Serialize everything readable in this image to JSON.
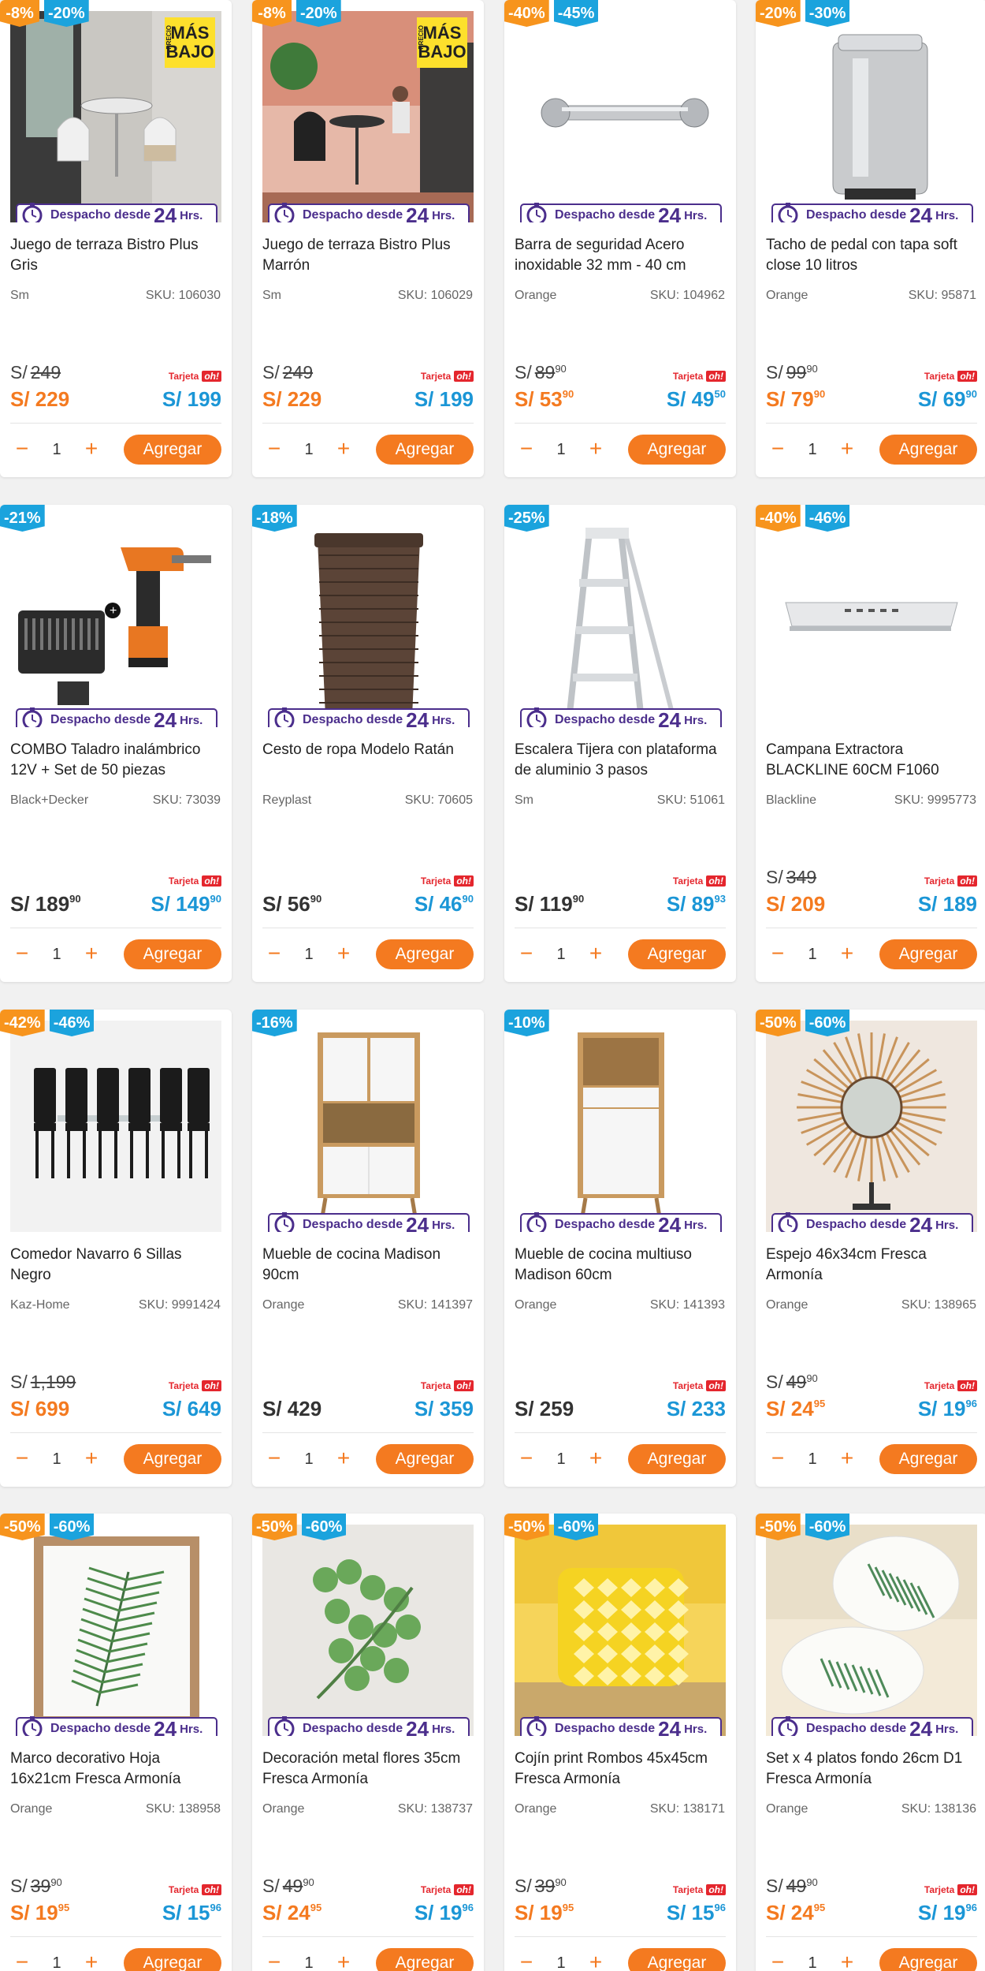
{
  "products": [
    {
      "badges": [
        {
          "text": "-8%",
          "color": "orange"
        },
        {
          "text": "-20%",
          "color": "blue"
        }
      ],
      "promo": {
        "small": "PRECIO",
        "text": "MÁS BAJO"
      },
      "dispatch": true,
      "name": "Juego de terraza Bistro Plus Gris",
      "brand": "Sm",
      "sku": "SKU: 106030",
      "old_label": "S/",
      "old_price": "249",
      "price": "S/ 229",
      "price_sup": "",
      "card_label": "Tarjeta",
      "oh_label": "oh!",
      "oh_price": "S/ 199",
      "oh_sup": "",
      "qty": "1",
      "add_label": "Agregar",
      "image": "terrace-gray"
    },
    {
      "badges": [
        {
          "text": "-8%",
          "color": "orange"
        },
        {
          "text": "-20%",
          "color": "blue"
        }
      ],
      "promo": {
        "small": "PRECIO",
        "text": "MÁS BAJO"
      },
      "dispatch": true,
      "name": "Juego de terraza Bistro Plus Marrón",
      "brand": "Sm",
      "sku": "SKU: 106029",
      "old_label": "S/",
      "old_price": "249",
      "price": "S/ 229",
      "price_sup": "",
      "card_label": "Tarjeta",
      "oh_label": "oh!",
      "oh_price": "S/ 199",
      "oh_sup": "",
      "qty": "1",
      "add_label": "Agregar",
      "image": "terrace-brown"
    },
    {
      "badges": [
        {
          "text": "-40%",
          "color": "orange"
        },
        {
          "text": "-45%",
          "color": "blue"
        }
      ],
      "promo": null,
      "dispatch": true,
      "name": "Barra de seguridad Acero inoxidable 32 mm - 40 cm",
      "brand": "Orange",
      "sku": "SKU: 104962",
      "old_label": "S/",
      "old_price": "89",
      "old_sup": "90",
      "price": "S/ 53",
      "price_sup": "90",
      "card_label": "Tarjeta",
      "oh_label": "oh!",
      "oh_price": "S/ 49",
      "oh_sup": "50",
      "qty": "1",
      "add_label": "Agregar",
      "image": "grab-bar"
    },
    {
      "badges": [
        {
          "text": "-20%",
          "color": "orange"
        },
        {
          "text": "-30%",
          "color": "blue"
        }
      ],
      "promo": null,
      "dispatch": true,
      "name": "Tacho de pedal con tapa soft close 10 litros",
      "brand": "Orange",
      "sku": "SKU: 95871",
      "old_label": "S/",
      "old_price": "99",
      "old_sup": "90",
      "price": "S/ 79",
      "price_sup": "90",
      "card_label": "Tarjeta",
      "oh_label": "oh!",
      "oh_price": "S/ 69",
      "oh_sup": "90",
      "qty": "1",
      "add_label": "Agregar",
      "image": "trash-bin"
    },
    {
      "badges": [
        {
          "text": "-21%",
          "color": "blue"
        }
      ],
      "promo": null,
      "dispatch": true,
      "name": "COMBO Taladro inalámbrico 12V + Set de 50 piezas",
      "brand": "Black+Decker",
      "sku": "SKU: 73039",
      "old_label": "",
      "old_price": "",
      "price": "S/ 189",
      "price_sup": "90",
      "price_plain": true,
      "card_label": "Tarjeta",
      "oh_label": "oh!",
      "oh_price": "S/ 149",
      "oh_sup": "90",
      "qty": "1",
      "add_label": "Agregar",
      "image": "drill"
    },
    {
      "badges": [
        {
          "text": "-18%",
          "color": "blue"
        }
      ],
      "promo": null,
      "dispatch": true,
      "name": "Cesto de ropa Modelo Ratán",
      "brand": "Reyplast",
      "sku": "SKU: 70605",
      "old_label": "",
      "old_price": "",
      "price": "S/ 56",
      "price_sup": "90",
      "price_plain": true,
      "card_label": "Tarjeta",
      "oh_label": "oh!",
      "oh_price": "S/ 46",
      "oh_sup": "90",
      "qty": "1",
      "add_label": "Agregar",
      "image": "basket"
    },
    {
      "badges": [
        {
          "text": "-25%",
          "color": "blue"
        }
      ],
      "promo": null,
      "dispatch": true,
      "name": "Escalera Tijera con plataforma de aluminio 3 pasos",
      "brand": "Sm",
      "sku": "SKU: 51061",
      "old_label": "",
      "old_price": "",
      "price": "S/ 119",
      "price_sup": "90",
      "price_plain": true,
      "card_label": "Tarjeta",
      "oh_label": "oh!",
      "oh_price": "S/ 89",
      "oh_sup": "93",
      "qty": "1",
      "add_label": "Agregar",
      "image": "ladder"
    },
    {
      "badges": [
        {
          "text": "-40%",
          "color": "orange"
        },
        {
          "text": "-46%",
          "color": "blue"
        }
      ],
      "promo": null,
      "dispatch": false,
      "name": "Campana Extractora BLACKLINE 60CM F1060",
      "brand": "Blackline",
      "sku": "SKU: 9995773",
      "old_label": "S/",
      "old_price": "349",
      "price": "S/ 209",
      "price_sup": "",
      "card_label": "Tarjeta",
      "oh_label": "oh!",
      "oh_price": "S/ 189",
      "oh_sup": "",
      "qty": "1",
      "add_label": "Agregar",
      "image": "hood"
    },
    {
      "badges": [
        {
          "text": "-42%",
          "color": "orange"
        },
        {
          "text": "-46%",
          "color": "blue"
        }
      ],
      "promo": null,
      "dispatch": false,
      "name": "Comedor Navarro 6 Sillas Negro",
      "brand": "Kaz-Home",
      "sku": "SKU: 9991424",
      "old_label": "S/",
      "old_price": "1,199",
      "price": "S/ 699",
      "price_sup": "",
      "card_label": "Tarjeta",
      "oh_label": "oh!",
      "oh_price": "S/ 649",
      "oh_sup": "",
      "qty": "1",
      "add_label": "Agregar",
      "image": "dining"
    },
    {
      "badges": [
        {
          "text": "-16%",
          "color": "blue"
        }
      ],
      "promo": null,
      "dispatch": true,
      "name": "Mueble de cocina Madison 90cm",
      "brand": "Orange",
      "sku": "SKU: 141397",
      "old_label": "",
      "old_price": "",
      "price": "S/ 429",
      "price_sup": "",
      "price_plain": true,
      "card_label": "Tarjeta",
      "oh_label": "oh!",
      "oh_price": "S/ 359",
      "oh_sup": "",
      "qty": "1",
      "add_label": "Agregar",
      "image": "cabinet-wide"
    },
    {
      "badges": [
        {
          "text": "-10%",
          "color": "blue"
        }
      ],
      "promo": null,
      "dispatch": true,
      "name": "Mueble de cocina multiuso Madison 60cm",
      "brand": "Orange",
      "sku": "SKU: 141393",
      "old_label": "",
      "old_price": "",
      "price": "S/ 259",
      "price_sup": "",
      "price_plain": true,
      "card_label": "Tarjeta",
      "oh_label": "oh!",
      "oh_price": "S/ 233",
      "oh_sup": "",
      "qty": "1",
      "add_label": "Agregar",
      "image": "cabinet-tall"
    },
    {
      "badges": [
        {
          "text": "-50%",
          "color": "orange"
        },
        {
          "text": "-60%",
          "color": "blue"
        }
      ],
      "promo": null,
      "dispatch": true,
      "name": "Espejo 46x34cm Fresca Armonía",
      "brand": "Orange",
      "sku": "SKU: 138965",
      "old_label": "S/",
      "old_price": "49",
      "old_sup": "90",
      "price": "S/ 24",
      "price_sup": "95",
      "card_label": "Tarjeta",
      "oh_label": "oh!",
      "oh_price": "S/ 19",
      "oh_sup": "96",
      "qty": "1",
      "add_label": "Agregar",
      "image": "mirror"
    },
    {
      "badges": [
        {
          "text": "-50%",
          "color": "orange"
        },
        {
          "text": "-60%",
          "color": "blue"
        }
      ],
      "promo": null,
      "dispatch": true,
      "name": "Marco decorativo Hoja 16x21cm Fresca Armonía",
      "brand": "Orange",
      "sku": "SKU: 138958",
      "old_label": "S/",
      "old_price": "39",
      "old_sup": "90",
      "price": "S/ 19",
      "price_sup": "95",
      "card_label": "Tarjeta",
      "oh_label": "oh!",
      "oh_price": "S/ 15",
      "oh_sup": "96",
      "qty": "1",
      "add_label": "Agregar",
      "image": "frame"
    },
    {
      "badges": [
        {
          "text": "-50%",
          "color": "orange"
        },
        {
          "text": "-60%",
          "color": "blue"
        }
      ],
      "promo": null,
      "dispatch": true,
      "name": "Decoración metal flores 35cm Fresca Armonía",
      "brand": "Orange",
      "sku": "SKU: 138737",
      "old_label": "S/",
      "old_price": "49",
      "old_sup": "90",
      "price": "S/ 24",
      "price_sup": "95",
      "card_label": "Tarjeta",
      "oh_label": "oh!",
      "oh_price": "S/ 19",
      "oh_sup": "96",
      "qty": "1",
      "add_label": "Agregar",
      "image": "metal-flowers"
    },
    {
      "badges": [
        {
          "text": "-50%",
          "color": "orange"
        },
        {
          "text": "-60%",
          "color": "blue"
        }
      ],
      "promo": null,
      "dispatch": true,
      "name": "Cojín print Rombos 45x45cm Fresca Armonía",
      "brand": "Orange",
      "sku": "SKU: 138171",
      "old_label": "S/",
      "old_price": "39",
      "old_sup": "90",
      "price": "S/ 19",
      "price_sup": "95",
      "card_label": "Tarjeta",
      "oh_label": "oh!",
      "oh_price": "S/ 15",
      "oh_sup": "96",
      "qty": "1",
      "add_label": "Agregar",
      "image": "cushion"
    },
    {
      "badges": [
        {
          "text": "-50%",
          "color": "orange"
        },
        {
          "text": "-60%",
          "color": "blue"
        }
      ],
      "promo": null,
      "dispatch": true,
      "name": "Set x 4 platos fondo 26cm D1 Fresca Armonía",
      "brand": "Orange",
      "sku": "SKU: 138136",
      "old_label": "S/",
      "old_price": "49",
      "old_sup": "90",
      "price": "S/ 24",
      "price_sup": "95",
      "card_label": "Tarjeta",
      "oh_label": "oh!",
      "oh_price": "S/ 19",
      "oh_sup": "96",
      "qty": "1",
      "add_label": "Agregar",
      "image": "plates"
    }
  ],
  "dispatch_text": "Despacho desde",
  "dispatch_num": "24",
  "dispatch_unit": "Hrs.",
  "colors": {
    "accent": "#f47a20",
    "oh_blue": "#1b96d6",
    "badge_orange": "#f7941d",
    "badge_blue": "#1ba3dd",
    "dispatch_purple": "#4b2e8c"
  }
}
